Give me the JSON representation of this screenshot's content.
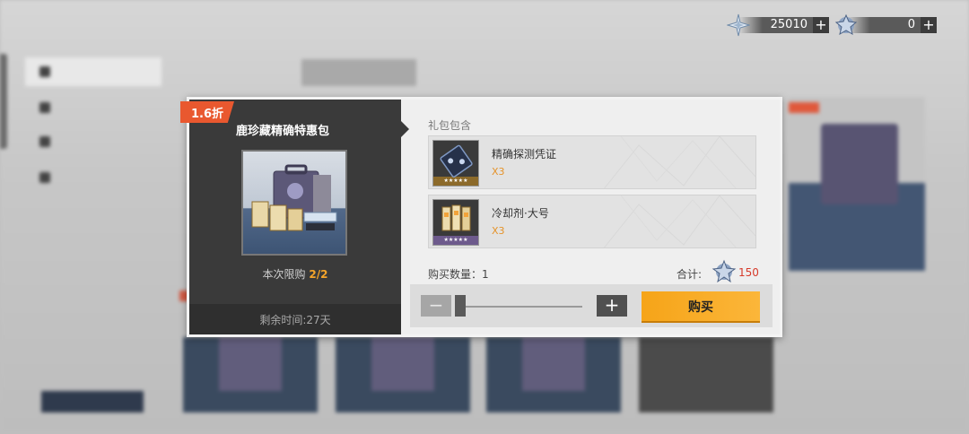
{
  "currency": {
    "gems": {
      "icon": "star-crystal-icon",
      "value": "25010"
    },
    "tickets": {
      "icon": "snowflake-crystal-icon",
      "value": "0"
    }
  },
  "dialog": {
    "discount": "1.6折",
    "pack_title": "鹿珍藏精确特惠包",
    "limit_label": "本次限购",
    "limit_value": "2/2",
    "remaining_time": "剩余时间:27天",
    "contents_label": "礼包包含",
    "items": [
      {
        "name": "精确探测凭证",
        "qty": "X3",
        "icon": "probe-voucher-icon"
      },
      {
        "name": "冷却剂·大号",
        "qty": "X3",
        "icon": "coolant-large-icon"
      }
    ],
    "buy_qty_label": "购买数量：",
    "buy_qty_value": "1",
    "quantity_fraction": 0.0,
    "total_label": "合计:",
    "total_value": "150",
    "buy_label": "购买"
  },
  "colors": {
    "discount_tag": "#e9582f",
    "buy_button": "#f6a418",
    "limit_highlight": "#f5a52a",
    "price_red": "#d63a2a",
    "qty_orange": "#e5932a"
  }
}
